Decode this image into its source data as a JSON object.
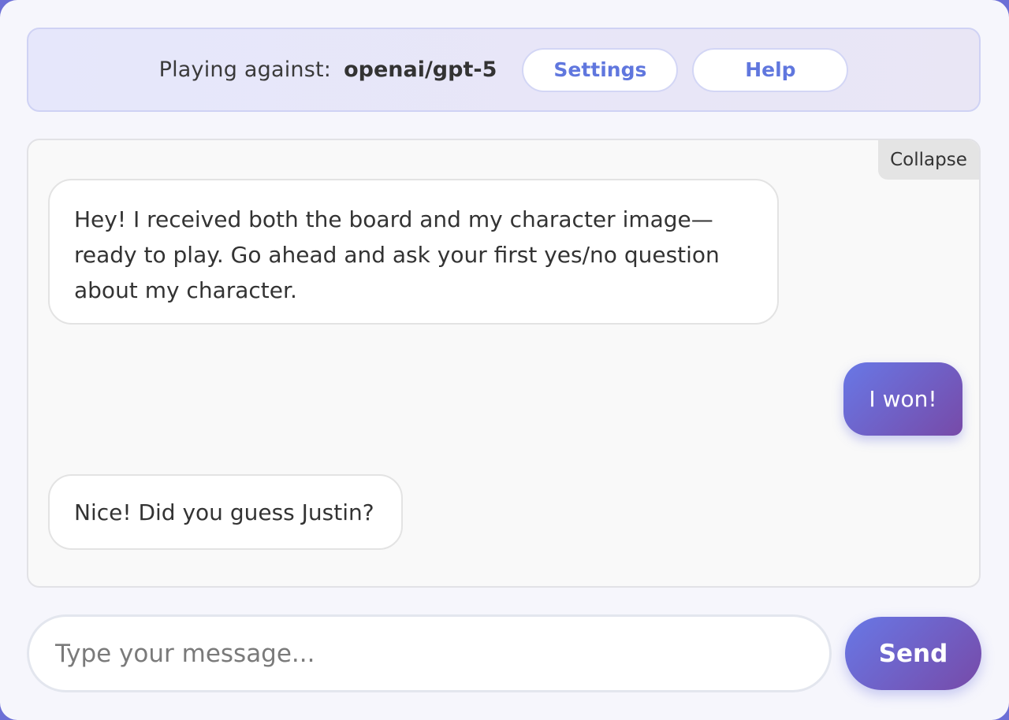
{
  "header": {
    "playing_label": "Playing against:",
    "opponent": "openai/gpt-5",
    "settings_label": "Settings",
    "help_label": "Help"
  },
  "chat": {
    "collapse_label": "Collapse",
    "messages": [
      {
        "role": "assistant",
        "text": "Hey! I received both the board and my character image—ready to play. Go ahead and ask your first yes/no question about my character."
      },
      {
        "role": "user",
        "text": "I won!"
      },
      {
        "role": "assistant",
        "text": "Nice! Did you guess Justin?"
      }
    ]
  },
  "composer": {
    "placeholder": "Type your message...",
    "value": "",
    "send_label": "Send"
  },
  "colors": {
    "accent_start": "#6878e6",
    "accent_end": "#774aa8",
    "link_blue": "#6077de"
  }
}
